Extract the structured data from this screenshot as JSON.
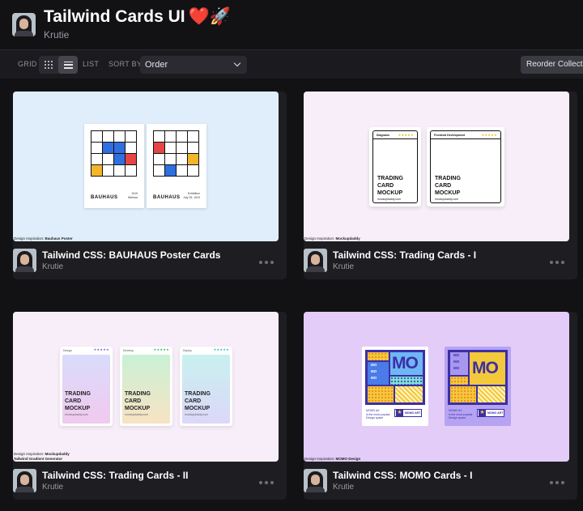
{
  "header": {
    "title": "Tailwind Cards UI",
    "title_emoji": "❤️🚀",
    "author": "Krutie"
  },
  "toolbar": {
    "grid_label": "GRID",
    "list_label": "LIST",
    "sort_label": "SORT BY",
    "sort_value": "Order",
    "reorder_label": "Reorder Collection",
    "active_view": "list"
  },
  "cards": [
    {
      "title": "Tailwind CSS: BAUHAUS Poster Cards",
      "author": "Krutie",
      "caption_prefix": "Design Inspiration:",
      "caption_value": "Bauhaus Poster",
      "preview": {
        "name": "BAUHAUS",
        "poster1_meta": [
          "1919",
          "Weimar"
        ],
        "poster2_meta": [
          "Exhibition",
          "July 25, 1923"
        ]
      }
    },
    {
      "title": "Tailwind CSS: Trading Cards - I",
      "author": "Krutie",
      "caption_prefix": "Design Inspiration:",
      "caption_value": "Mockupdaddy",
      "preview": {
        "tab1": "Diagrams",
        "tab2": "Frontend Development",
        "stars": "★★★★★",
        "line1": "TRADING",
        "line2": "CARD",
        "line3": "MOCKUP",
        "sub": "mockupdaddy.com"
      }
    },
    {
      "title": "Tailwind CSS: Trading Cards - II",
      "author": "Krutie",
      "caption_prefix": "Design Inspiration:",
      "caption_value": "Mockupdaddy",
      "caption_line2": "Tailwind Gradient Generator",
      "preview": {
        "tab1": "Design",
        "tab2": "Develop",
        "tab3": "Deploy",
        "stars": "★★★★★",
        "line1": "TRADING",
        "line2": "CARD",
        "line3": "MOCKUP",
        "sub": "mockupdaddy.com"
      }
    },
    {
      "title": "Tailwind CSS: MOMO Cards - I",
      "author": "Krutie",
      "caption_prefix": "Design Inspiration:",
      "caption_value": "MOMO Design",
      "preview": {
        "big": "MO",
        "small": "MO",
        "foot1": "MOMO Art",
        "foot2": "is the most popular",
        "foot3": "Design space",
        "badge": "MOMO ART"
      }
    }
  ],
  "colors": {
    "background": "#121215",
    "toolbar": "#1b1b1f",
    "bauhaus_bg": "#dfeefa",
    "trading1_bg": "#f7eef9",
    "trading2_bg": "#f8eef9",
    "momo_bg": "#e3ccf7"
  }
}
